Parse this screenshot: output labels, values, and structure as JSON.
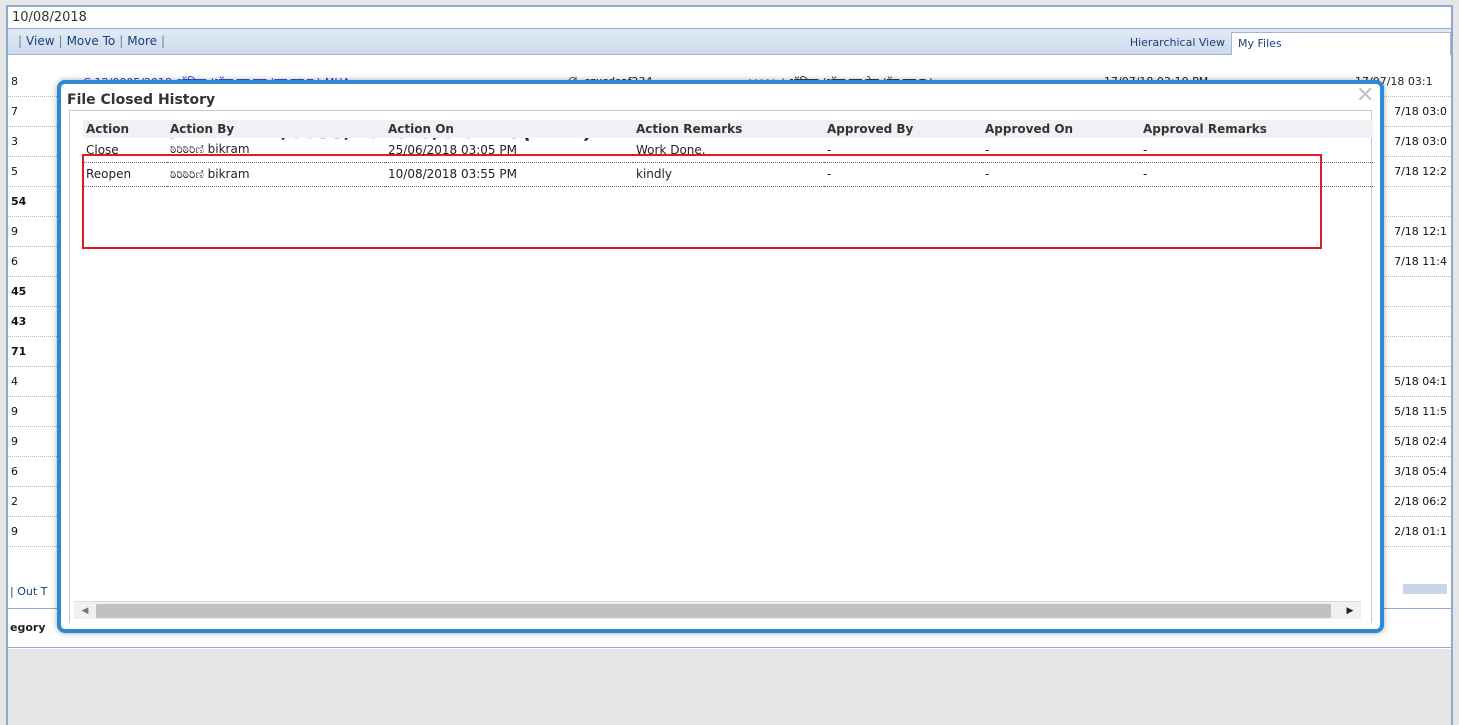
{
  "background": {
    "date": "10/08/2018",
    "toolbar_links": [
      "View",
      "Move To",
      "More"
    ],
    "tabs": [
      "Hierarchical View",
      "My Files"
    ],
    "first_row": {
      "num": "8",
      "file": "C-12/0005/2018-ऑफिस /ऑफ एच एस (एम एच ए )-MHA",
      "subject": "czxcdsaf234",
      "owner": "ಠಿರಿಠಿರಿಠಿಣಿ.ऑफिस /ऑफ एच ऐस (ऍम एच ए )",
      "date1": "17/07/18 03:10 PM",
      "dash": "-",
      "date2": "17/07/18 03:1"
    },
    "rows": [
      {
        "left": "7",
        "right": "7/18 03:0",
        "bold": false
      },
      {
        "left": "3",
        "right": "7/18 03:0",
        "bold": false
      },
      {
        "left": "5",
        "right": "7/18 12:2",
        "bold": false
      },
      {
        "left": "54",
        "right": "",
        "bold": true
      },
      {
        "left": "9",
        "right": "7/18 12:1",
        "bold": false
      },
      {
        "left": "6",
        "right": "7/18 11:4",
        "bold": false
      },
      {
        "left": "45",
        "right": "",
        "bold": true
      },
      {
        "left": "43",
        "right": "",
        "bold": true
      },
      {
        "left": "71",
        "right": "",
        "bold": true
      },
      {
        "left": "4",
        "right": "5/18 04:1",
        "bold": false
      },
      {
        "left": "9",
        "right": "5/18 11:5",
        "bold": false
      },
      {
        "left": "9",
        "right": "5/18 02:4",
        "bold": false
      },
      {
        "left": "6",
        "right": "3/18 05:4",
        "bold": false
      },
      {
        "left": "2",
        "right": "2/18 06:2",
        "bold": false
      },
      {
        "left": "9",
        "right": "2/18 01:1",
        "bold": false
      }
    ],
    "out_tab": "Out T",
    "category_label": "egory"
  },
  "modal": {
    "title": "File Closed History",
    "close_glyph": "✕",
    "file_number": "FILE NUMBER - A/0033/2018-O/o of HS(MHA)",
    "columns": [
      "Action",
      "Action By",
      "Action On",
      "Action Remarks",
      "Approved By",
      "Approved On",
      "Approval Remarks"
    ],
    "rows": [
      {
        "action": "Close",
        "by": "ಠಿರಿಠಿರಿಣಿ bikram",
        "on": "25/06/2018 03:05 PM",
        "remarks": "Work Done.",
        "approved_by": "-",
        "approved_on": "-",
        "approval_remarks": "-"
      },
      {
        "action": "Reopen",
        "by": "ಠಿರಿಠಿರಿಣಿ bikram",
        "on": "10/08/2018 03:55 PM",
        "remarks": "kindly",
        "approved_by": "-",
        "approved_on": "-",
        "approval_remarks": "-"
      }
    ]
  },
  "colors": {
    "modal_border": "#2b8ad8",
    "highlight": "#e01b24"
  }
}
